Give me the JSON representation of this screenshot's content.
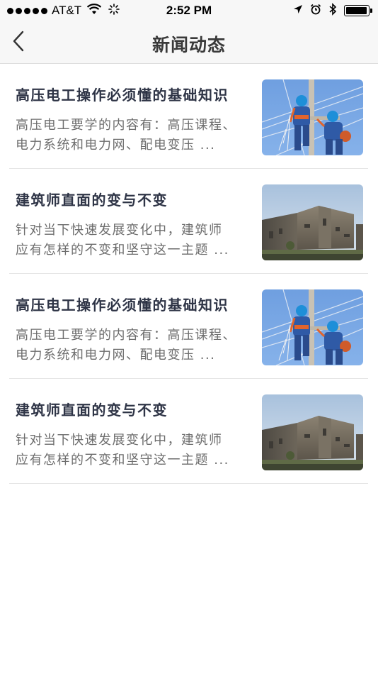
{
  "status_bar": {
    "carrier": "AT&T",
    "time": "2:52 PM",
    "battery_level": 0.95
  },
  "nav": {
    "title": "新闻动态",
    "back_icon": "chevron-left-icon"
  },
  "news": [
    {
      "title": "高压电工操作必须懂的基础知识",
      "summary_line1": "高压电工要学的内容有：高压课程、",
      "summary_line2": "电力系统和电力网、配电变压 ...",
      "image": "electricians-on-pole"
    },
    {
      "title": "建筑师直面的变与不变",
      "summary_line1": "针对当下快速发展变化中，建筑师",
      "summary_line2": "应有怎样的不变和坚守这一主题 ...",
      "image": "stone-building"
    },
    {
      "title": "高压电工操作必须懂的基础知识",
      "summary_line1": "高压电工要学的内容有：高压课程、",
      "summary_line2": "电力系统和电力网、配电变压 ...",
      "image": "electricians-on-pole"
    },
    {
      "title": "建筑师直面的变与不变",
      "summary_line1": "针对当下快速发展变化中，建筑师",
      "summary_line2": "应有怎样的不变和坚守这一主题 ...",
      "image": "stone-building"
    }
  ]
}
